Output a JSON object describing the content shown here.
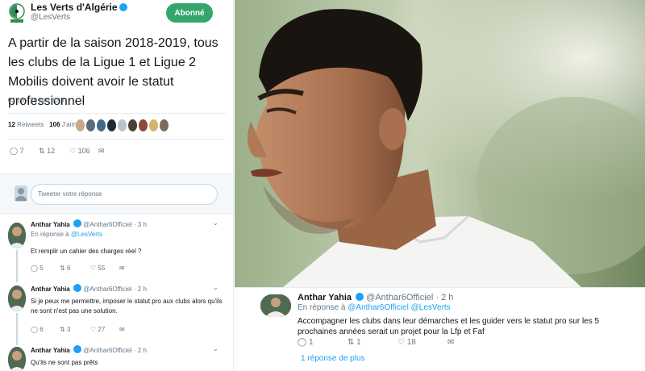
{
  "main_tweet": {
    "account_name": "Les Verts d'Algérie",
    "handle": "@LesVerts",
    "follow_label": "Abonné",
    "text": "A partir de la saison 2018-2019, tous les clubs de la Ligue 1 et Ligue 2 Mobilis doivent avoir le statut professionnel",
    "timestamp": "03:18 - 29 juin 2017",
    "retweets_count": "12",
    "retweets_label": "Retweets",
    "likes_count": "106",
    "likes_label": "J'aime",
    "actions": {
      "replies": "7",
      "retweets": "12",
      "likes": "106"
    }
  },
  "reply_box": {
    "placeholder": "Tweeter votre réponse"
  },
  "replies": [
    {
      "name": "Anthar Yahia",
      "handle": "@Anthar6Officiel",
      "time": "· 3 h",
      "reply_prefix": "En réponse à",
      "reply_to": "@LesVerts",
      "text": "Et remplir un cahier des charges réel ?",
      "actions": {
        "replies": "5",
        "retweets": "6",
        "likes": "55"
      }
    },
    {
      "name": "Anthar Yahia",
      "handle": "@Anthar6Officiel",
      "time": "· 2 h",
      "text": "Si je peux me permettre, imposer le statut pro aux clubs alors qu'ils ne sont n'est pas une solution.",
      "actions": {
        "replies": "6",
        "retweets": "3",
        "likes": "27"
      }
    },
    {
      "name": "Anthar Yahia",
      "handle": "@Anthar6Officiel",
      "time": "· 2 h",
      "text": "Qu'ils ne sont pas prêts"
    }
  ],
  "featured_reply": {
    "name": "Anthar Yahia",
    "handle": "@Anthar6Officiel",
    "time": "· 2 h",
    "reply_prefix": "En réponse à",
    "reply_to": "@Anthar6Officiel @LesVerts",
    "text": "Accompagner les clubs dans leur démarches et les guider vers le statut pro sur les 5 prochaines années serait un projet pour la Lfp et Faf",
    "actions": {
      "replies": "1",
      "retweets": "1",
      "likes": "18"
    },
    "more_replies": "1 réponse de plus"
  },
  "icons": [
    "reply-icon",
    "retweet-icon",
    "like-icon",
    "dm-icon",
    "verified-icon",
    "chevron-down-icon"
  ],
  "colors": {
    "follow_green": "#35a66b",
    "link_blue": "#1da1f2",
    "muted": "#657786"
  }
}
